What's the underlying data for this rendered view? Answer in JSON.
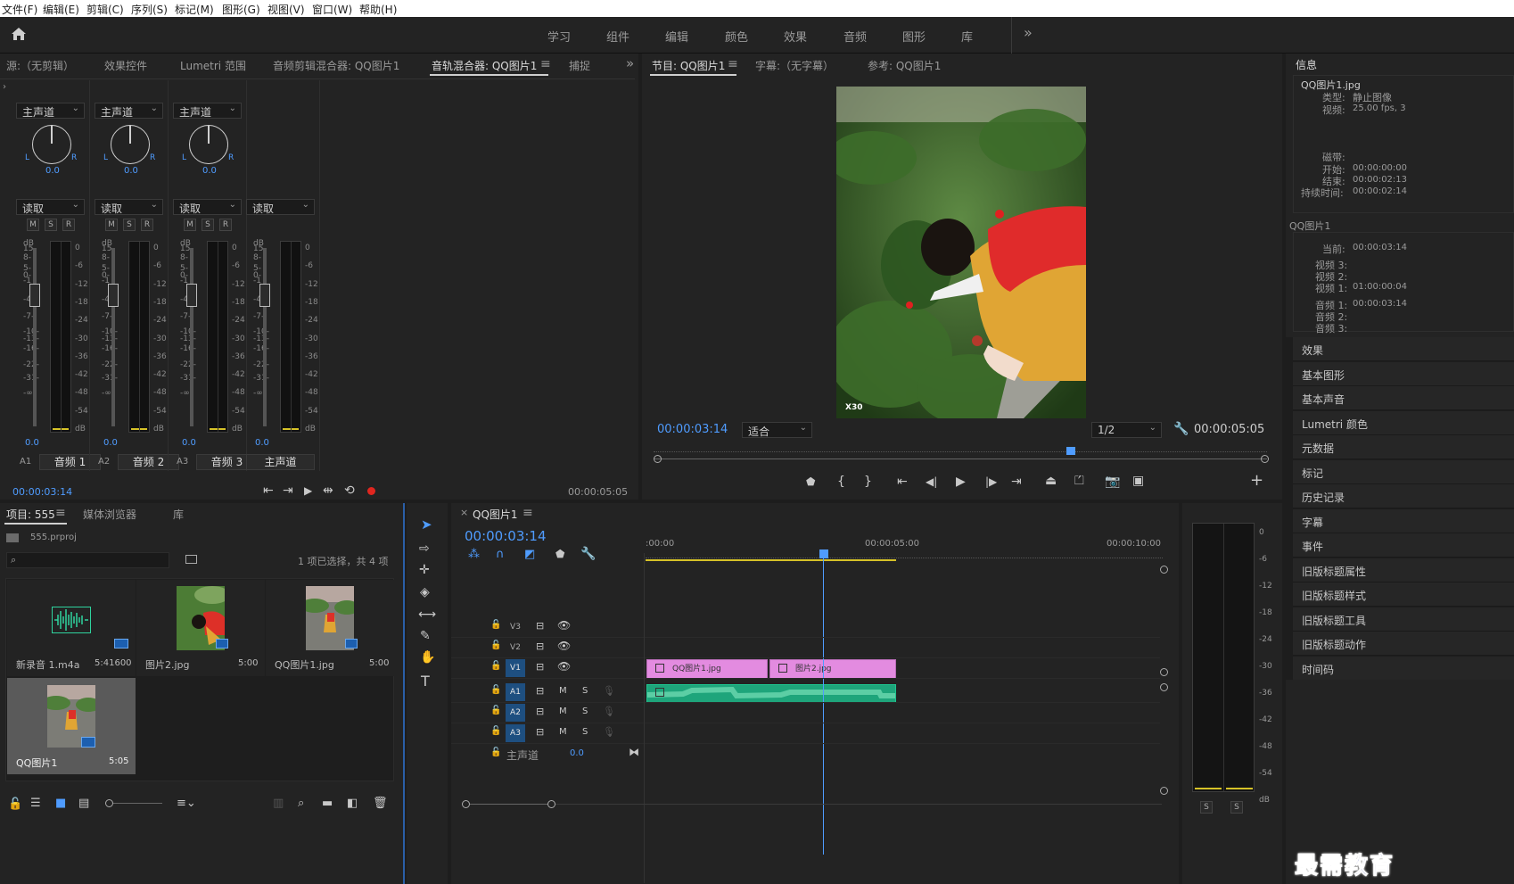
{
  "menu": [
    "文件(F)",
    "编辑(E)",
    "剪辑(C)",
    "序列(S)",
    "标记(M)",
    "图形(G)",
    "视图(V)",
    "窗口(W)",
    "帮助(H)"
  ],
  "workspaces": [
    "学习",
    "组件",
    "编辑",
    "颜色",
    "效果",
    "音频",
    "图形",
    "库"
  ],
  "ws_more": "»",
  "top_left_tabs": [
    "源:（无剪辑）",
    "效果控件",
    "Lumetri 范围",
    "音频剪辑混合器: QQ图片1",
    "音轨混合器: QQ图片1",
    "捕捉"
  ],
  "mixer": {
    "channels": [
      {
        "route": "主声道",
        "pan": "0.0",
        "mode": "读取",
        "level": "0.0",
        "id": "A1",
        "name": "音频 1",
        "fader_db": 0
      },
      {
        "route": "主声道",
        "pan": "0.0",
        "mode": "读取",
        "level": "0.0",
        "id": "A2",
        "name": "音频 2",
        "fader_db": 0
      },
      {
        "route": "主声道",
        "pan": "0.0",
        "mode": "读取",
        "level": "0.0",
        "id": "A3",
        "name": "音频 3",
        "fader_db": 0
      },
      {
        "mode": "读取",
        "level": "0.0",
        "name": "主声道",
        "fader_db": 0
      }
    ],
    "pan_l": "L",
    "pan_r": "R",
    "msr": [
      "M",
      "S",
      "R"
    ],
    "fader_scale": [
      "dB",
      "15-",
      "8-",
      "5-",
      "0-",
      "-1",
      "-4-",
      "-7-",
      "-10-",
      "-13-",
      "-16-",
      "-22-",
      "-31-",
      "-∞-"
    ],
    "meter_scale": [
      "0",
      "-6",
      "-12",
      "-18",
      "-24",
      "-30",
      "-36",
      "-42",
      "-48",
      "-54",
      "dB"
    ],
    "time_left": "00:00:03:14",
    "time_right": "00:00:05:05"
  },
  "program": {
    "tabs": [
      "节目: QQ图片1",
      "字幕:（无字幕）",
      "参考: QQ图片1"
    ],
    "timecode": "00:00:03:14",
    "fit": "适合",
    "res": "1/2",
    "duration": "00:00:05:05",
    "watermark": "X30",
    "playhead_fraction": 0.68
  },
  "info": {
    "title": "信息",
    "file": "QQ图片1.jpg",
    "type_k": "类型:",
    "type_v": "静止图像",
    "video_k": "视频:",
    "video_v": "25.00 fps, 3",
    "tape_k": "磁带:",
    "start_k": "开始:",
    "start_v": "00:00:00:00",
    "end_k": "结束:",
    "end_v": "00:00:02:13",
    "dur_k": "持续时间:",
    "dur_v": "00:00:02:14",
    "seq": "QQ图片1",
    "cur_k": "当前:",
    "cur_v": "00:00:03:14",
    "v3": "视频 3:",
    "v2": "视频 2:",
    "v1": "视频 1:",
    "v1_v": "01:00:00:04",
    "a1": "音频 1:",
    "a1_v": "00:00:03:14",
    "a2": "音频 2:",
    "a3": "音频 3:"
  },
  "right_panels": [
    "效果",
    "基本图形",
    "基本声音",
    "Lumetri 颜色",
    "元数据",
    "标记",
    "历史记录",
    "字幕",
    "事件",
    "旧版标题属性",
    "旧版标题样式",
    "旧版标题工具",
    "旧版标题动作",
    "时间码"
  ],
  "project": {
    "tabs": [
      "项目: 555",
      "媒体浏览器",
      "库"
    ],
    "file": "555.prproj",
    "status": "1 项已选择，共 4 项",
    "items": [
      {
        "name": "新录音 1.m4a",
        "dur": "5:41600",
        "kind": "audio"
      },
      {
        "name": "图片2.jpg",
        "dur": "5:00",
        "kind": "image"
      },
      {
        "name": "QQ图片1.jpg",
        "dur": "5:00",
        "kind": "image"
      },
      {
        "name": "QQ图片1",
        "dur": "5:05",
        "kind": "sequence",
        "selected": true
      }
    ]
  },
  "timeline": {
    "title": "QQ图片1",
    "timecode": "00:00:03:14",
    "ruler": [
      ":00:00",
      "00:00:05:00",
      "00:00:10:00"
    ],
    "video_tracks": [
      "V3",
      "V2",
      "V1"
    ],
    "audio_tracks": [
      "A1",
      "A2",
      "A3"
    ],
    "master": "主声道",
    "master_val": "0.0",
    "clips": [
      {
        "name": "QQ图片1.jpg"
      },
      {
        "name": "图片2.jpg"
      }
    ],
    "ms": [
      "M",
      "S"
    ]
  },
  "audio_meter": {
    "scale": [
      "0",
      "-6",
      "-12",
      "-18",
      "-24",
      "-30",
      "-36",
      "-42",
      "-48",
      "-54",
      "dB"
    ],
    "solo": [
      "S",
      "S"
    ]
  },
  "brand": "最需教育"
}
